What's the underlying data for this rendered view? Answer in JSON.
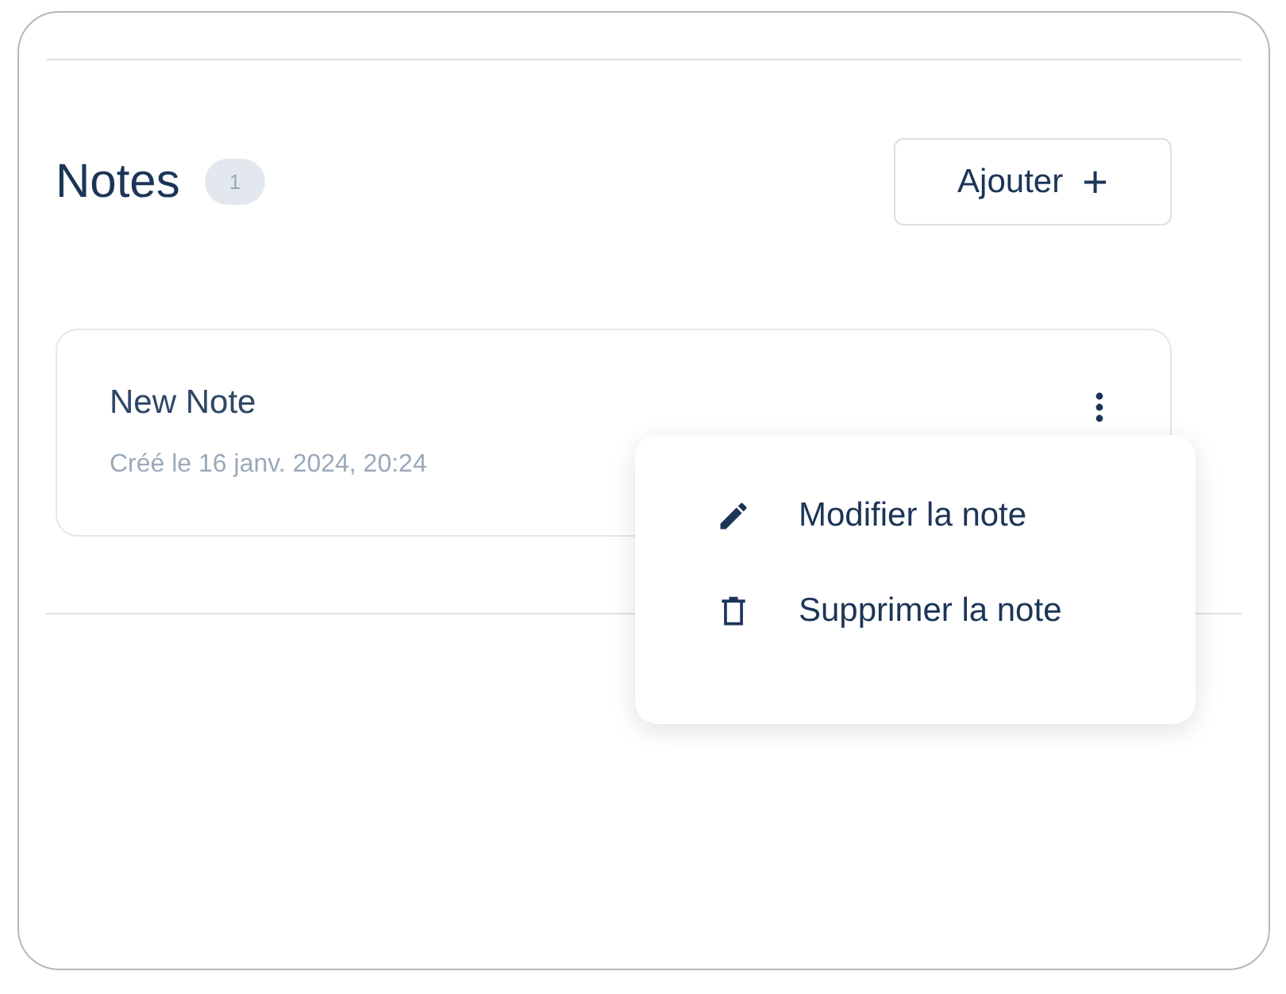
{
  "notes_section": {
    "title": "Notes",
    "count": "1",
    "add_button": "Ajouter +"
  },
  "notes": [
    {
      "title": "New Note",
      "created": "Créé le 16 janv. 2024, 20:24"
    }
  ],
  "menu": {
    "items": [
      {
        "kind": "edit",
        "label": "Modifier la note"
      },
      {
        "kind": "delete",
        "label": "Supprimer la note"
      }
    ]
  }
}
